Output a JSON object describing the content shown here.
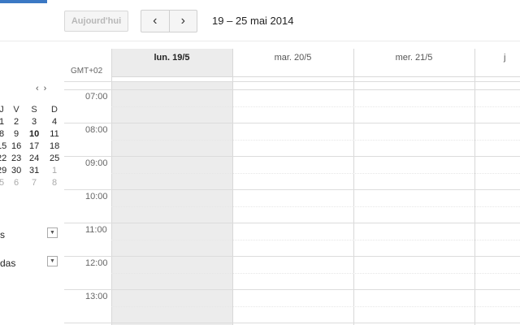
{
  "toolbar": {
    "today_label": "Aujourd'hui",
    "prev_icon": "‹",
    "next_icon": "›",
    "date_range": "19 – 25 mai 2014"
  },
  "mini_calendar": {
    "nav_prev": "‹",
    "nav_next": "›",
    "header": [
      "J",
      "V",
      "S",
      "D"
    ],
    "rows": [
      [
        "1",
        "2",
        "3",
        "4"
      ],
      [
        "8",
        "9",
        "10",
        "11"
      ],
      [
        "15",
        "16",
        "17",
        "18"
      ],
      [
        "22",
        "23",
        "24",
        "25"
      ],
      [
        "29",
        "30",
        "31",
        "1"
      ],
      [
        "5",
        "6",
        "7",
        "8"
      ]
    ]
  },
  "sidebar": {
    "section1_label": "s",
    "section2_label": "das"
  },
  "grid": {
    "timezone": "GMT+02",
    "days": [
      "lun. 19/5",
      "mar. 20/5",
      "mer. 21/5",
      "j"
    ],
    "hours": [
      "07:00",
      "08:00",
      "09:00",
      "10:00",
      "11:00",
      "12:00",
      "13:00"
    ]
  }
}
